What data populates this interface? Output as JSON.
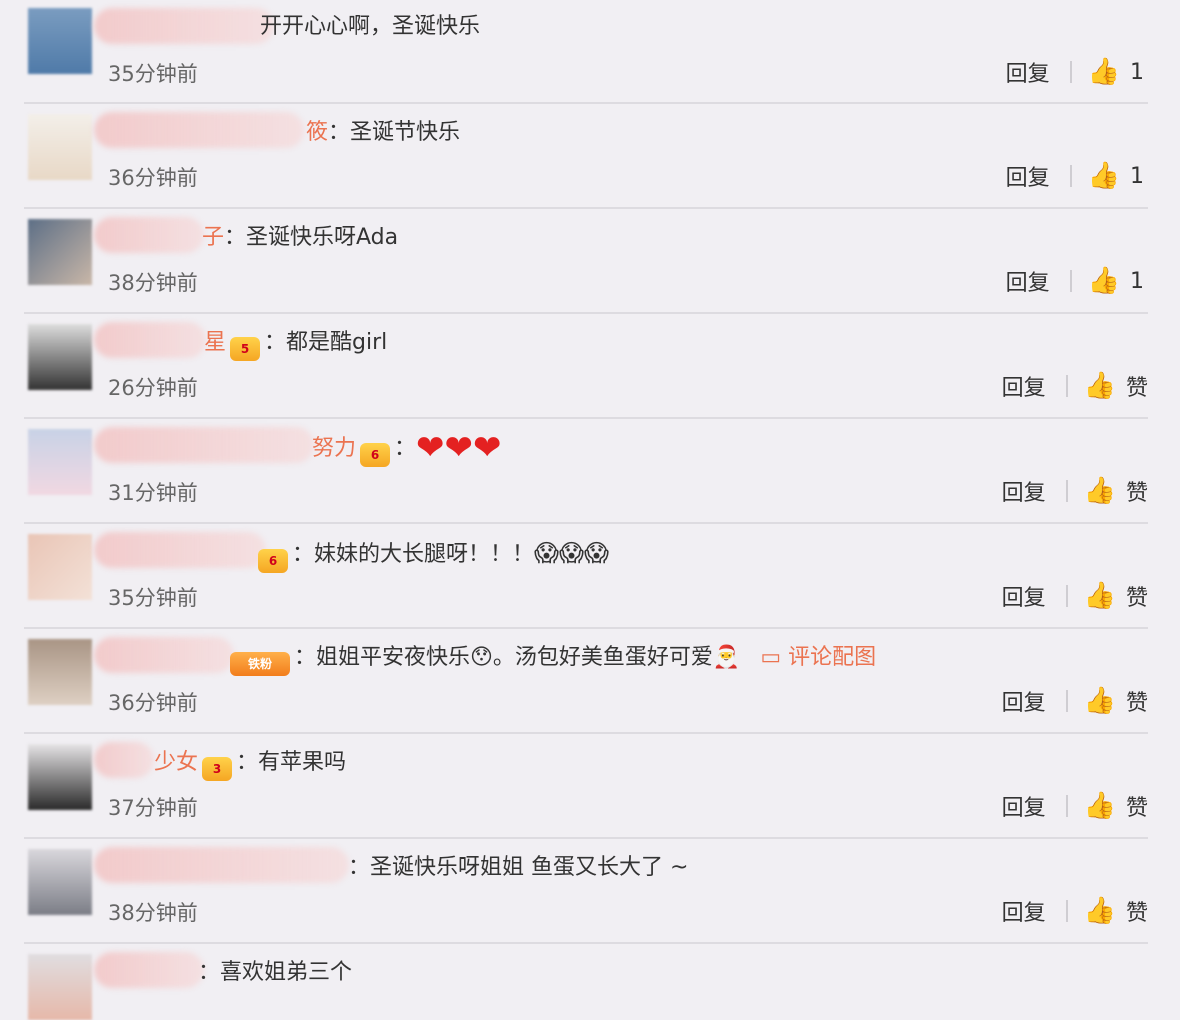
{
  "comments": [
    {
      "name": "",
      "badge": "",
      "text": "开开心心啊，圣诞快乐",
      "time": "35分钟前",
      "reply": "回复",
      "like": "1"
    },
    {
      "name": "筱",
      "badge": "",
      "text": "：圣诞节快乐",
      "time": "36分钟前",
      "reply": "回复",
      "like": "1"
    },
    {
      "name": "子",
      "badge": "",
      "text": "：圣诞快乐呀Ada",
      "time": "38分钟前",
      "reply": "回复",
      "like": "1"
    },
    {
      "name": "星",
      "badge": "5",
      "text": "：都是酷girl",
      "time": "26分钟前",
      "reply": "回复",
      "like": "赞"
    },
    {
      "name": "努力",
      "badge": "6",
      "text": "：",
      "hearts": "❤❤❤",
      "time": "31分钟前",
      "reply": "回复",
      "like": "赞"
    },
    {
      "name": "",
      "badge": "6",
      "text": "：妹妹的大长腿呀！！！",
      "emoji": "😱😱😱",
      "time": "35分钟前",
      "reply": "回复",
      "like": "赞"
    },
    {
      "name": "",
      "badge": "铁粉",
      "text": "：姐姐平安夜快乐😯。汤包好美鱼蛋好可爱🎅",
      "pic": "评论配图",
      "time": "36分钟前",
      "reply": "回复",
      "like": "赞"
    },
    {
      "name": "少女",
      "badge": "3",
      "text": "：有苹果吗",
      "time": "37分钟前",
      "reply": "回复",
      "like": "赞"
    },
    {
      "name": "",
      "badge": "",
      "text": "：圣诞快乐呀姐姐 鱼蛋又长大了 ~",
      "time": "38分钟前",
      "reply": "回复",
      "like": "赞"
    },
    {
      "name": "",
      "badge": "",
      "text": "：喜欢姐弟三个",
      "time": "",
      "reply": "",
      "like": ""
    }
  ],
  "icons": {
    "like": "thumbs-up-icon",
    "picture": "picture-icon"
  }
}
